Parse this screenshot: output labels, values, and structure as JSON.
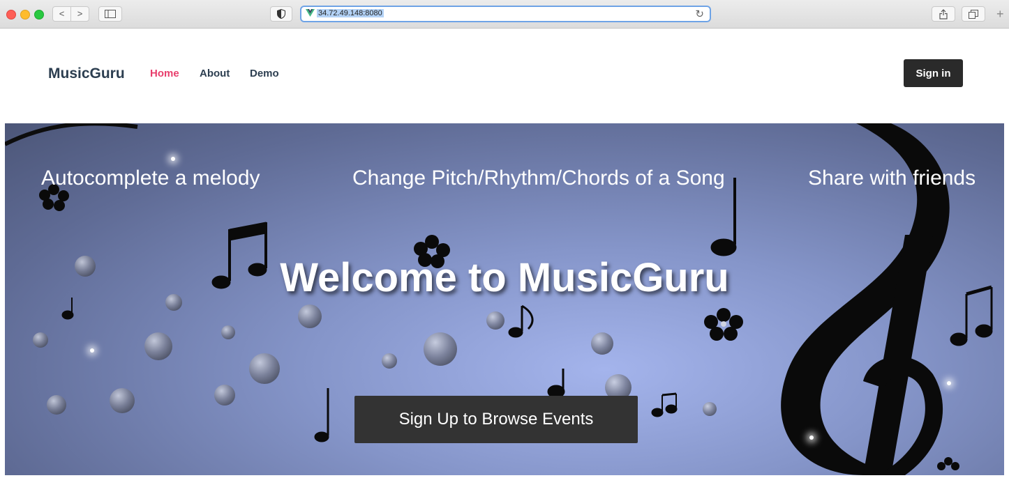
{
  "browser": {
    "url": "34.72.49.148:8080",
    "back_glyph": "<",
    "forward_glyph": ">",
    "new_tab_glyph": "+",
    "reload_glyph": "↻"
  },
  "header": {
    "brand": "MusicGuru",
    "nav": [
      {
        "label": "Home",
        "active": true
      },
      {
        "label": "About",
        "active": false
      },
      {
        "label": "Demo",
        "active": false
      }
    ],
    "signin_label": "Sign in",
    "accent_color": "#e83e6c"
  },
  "hero": {
    "features": [
      "Autocomplete a melody",
      "Change Pitch/Rhythm/Chords of a Song",
      "Share with friends"
    ],
    "title": "Welcome to MusicGuru",
    "cta_label": "Sign Up to Browse Events"
  },
  "icons": [
    "sidebar-icon",
    "shield-icon",
    "vue-icon",
    "reload-icon",
    "share-icon",
    "tabs-icon",
    "treble-clef-icon",
    "music-note-icon",
    "flower-icon"
  ]
}
